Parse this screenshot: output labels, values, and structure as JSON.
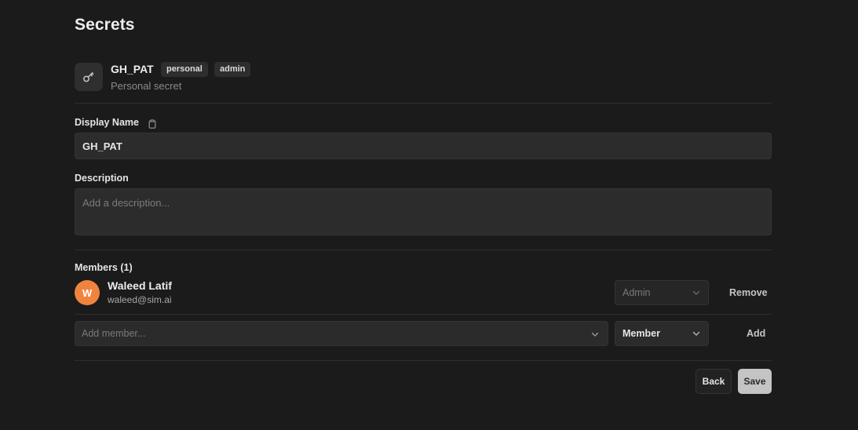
{
  "page": {
    "title": "Secrets"
  },
  "secret": {
    "icon": "key-icon",
    "name": "GH_PAT",
    "badges": [
      "personal",
      "admin"
    ],
    "subtitle": "Personal secret"
  },
  "form": {
    "display_name_label": "Display Name",
    "display_name_value": "GH_PAT",
    "copy_icon": "clipboard-icon",
    "description_label": "Description",
    "description_value": "",
    "description_placeholder": "Add a description..."
  },
  "members": {
    "label": "Members (1)",
    "list": [
      {
        "initial": "W",
        "name": "Waleed Latif",
        "email": "waleed@sim.ai",
        "role": "Admin",
        "action": "Remove"
      }
    ],
    "add_placeholder": "Add member...",
    "new_role": "Member",
    "add_label": "Add"
  },
  "footer": {
    "back_label": "Back",
    "save_label": "Save"
  },
  "colors": {
    "background": "#1b1b1b",
    "input": "#2c2c2c",
    "avatar": "#f0843f",
    "save_button": "#c4c4c4"
  }
}
